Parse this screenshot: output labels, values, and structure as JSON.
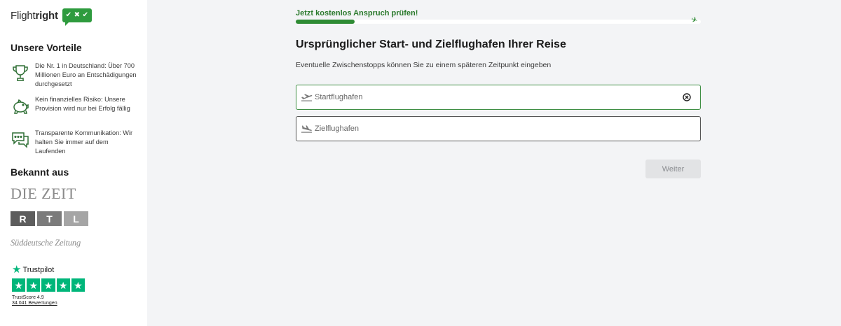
{
  "brand": {
    "name_light": "Flight",
    "name_bold": "right",
    "badge_marks": [
      "✔",
      "✖",
      "✔"
    ],
    "badge_color": "#2e9b3e"
  },
  "advantages": {
    "heading": "Unsere Vorteile",
    "items": [
      {
        "icon": "trophy-icon",
        "text": "Die Nr. 1 in Deutschland: Über 700 Millionen Euro an Entschädigungen durchgesetzt"
      },
      {
        "icon": "piggy-bank-icon",
        "text": "Kein finanzielles Risiko: Unsere Provision wird nur bei Erfolg fällig"
      },
      {
        "icon": "chat-bubbles-icon",
        "text": "Transparente Kommunikation: Wir halten Sie immer auf dem Laufenden"
      }
    ]
  },
  "press": {
    "heading": "Bekannt aus",
    "zeit_logo": "DIE ZEIT",
    "rtl_letters": [
      "R",
      "T",
      "L"
    ],
    "sz_logo": "Süddeutsche Zeitung"
  },
  "trustpilot": {
    "brand": "Trustpilot",
    "score_label": "TrustScore 4.9",
    "reviews_label": "34.041 Bewertungen",
    "rating": 5,
    "star_color": "#00b67a"
  },
  "progress": {
    "label": "Jetzt kostenlos Anspruch prüfen!",
    "fraction": 0.145,
    "color": "#2e8b34"
  },
  "form": {
    "title": "Ursprünglicher Start- und Zielflughafen Ihrer Reise",
    "subtitle": "Eventuelle Zwischenstopps können Sie zu einem späteren Zeitpunkt eingeben",
    "departure": {
      "placeholder": "Startflughafen",
      "value": ""
    },
    "arrival": {
      "placeholder": "Zielflughafen",
      "value": ""
    },
    "submit_label": "Weiter"
  }
}
